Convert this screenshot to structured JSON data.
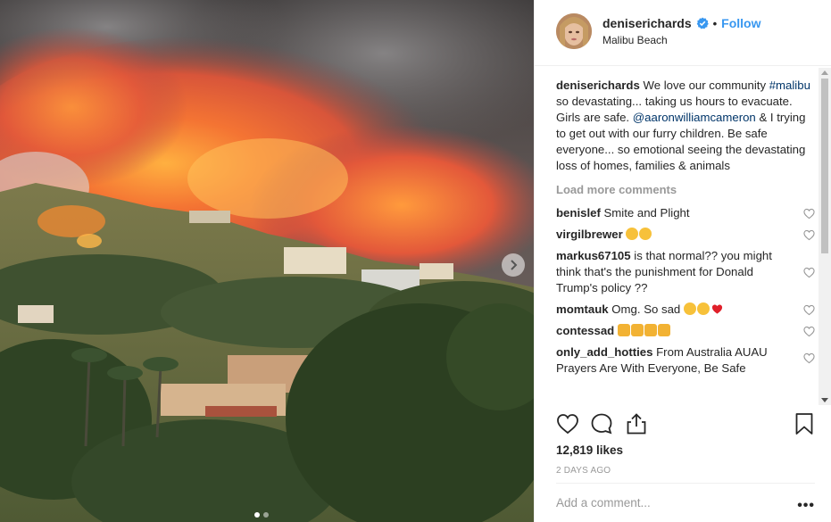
{
  "post": {
    "username": "deniserichards",
    "follow_label": "Follow",
    "bullet": "•",
    "location": "Malibu Beach",
    "caption": {
      "username": "deniserichards",
      "text_1": "We love our community",
      "hashtag": "#malibu",
      "text_2": "so devastating... taking us hours to evacuate. Girls are safe.",
      "mention": "@aaronwilliamcameron",
      "text_3": "& I trying to get out with our furry children. Be safe everyone... so emotional seeing the devastating loss of homes, families & animals"
    },
    "load_more": "Load more comments",
    "comments": [
      {
        "user": "benislef",
        "text": "Smite and Plight"
      },
      {
        "user": "virgilbrewer",
        "text": ""
      },
      {
        "user": "markus67105",
        "text": "is that normal?? you might think that's the punishment for Donald Trump's policy ??"
      },
      {
        "user": "momtauk",
        "text": "Omg. So sad"
      },
      {
        "user": "contessad",
        "text": ""
      },
      {
        "user": "only_add_hotties",
        "text": "From Australia AUAU Prayers Are With Everyone, Be Safe"
      }
    ],
    "likes": "12,819 likes",
    "time_ago": "2 DAYS AGO",
    "add_comment_placeholder": "Add a comment...",
    "more_options": "•••"
  },
  "colors": {
    "accent": "#3897f0",
    "link": "#003569",
    "muted": "#999999",
    "heart_red": "#ed4956",
    "emoji_yellow": "#f7c13a"
  },
  "icons": {
    "verified": "verified-badge-icon",
    "like": "heart-icon",
    "comment": "comment-bubble-icon",
    "share": "share-icon",
    "save": "bookmark-icon",
    "next": "chevron-right-icon"
  },
  "carousel": {
    "count": 2,
    "active": 1
  }
}
